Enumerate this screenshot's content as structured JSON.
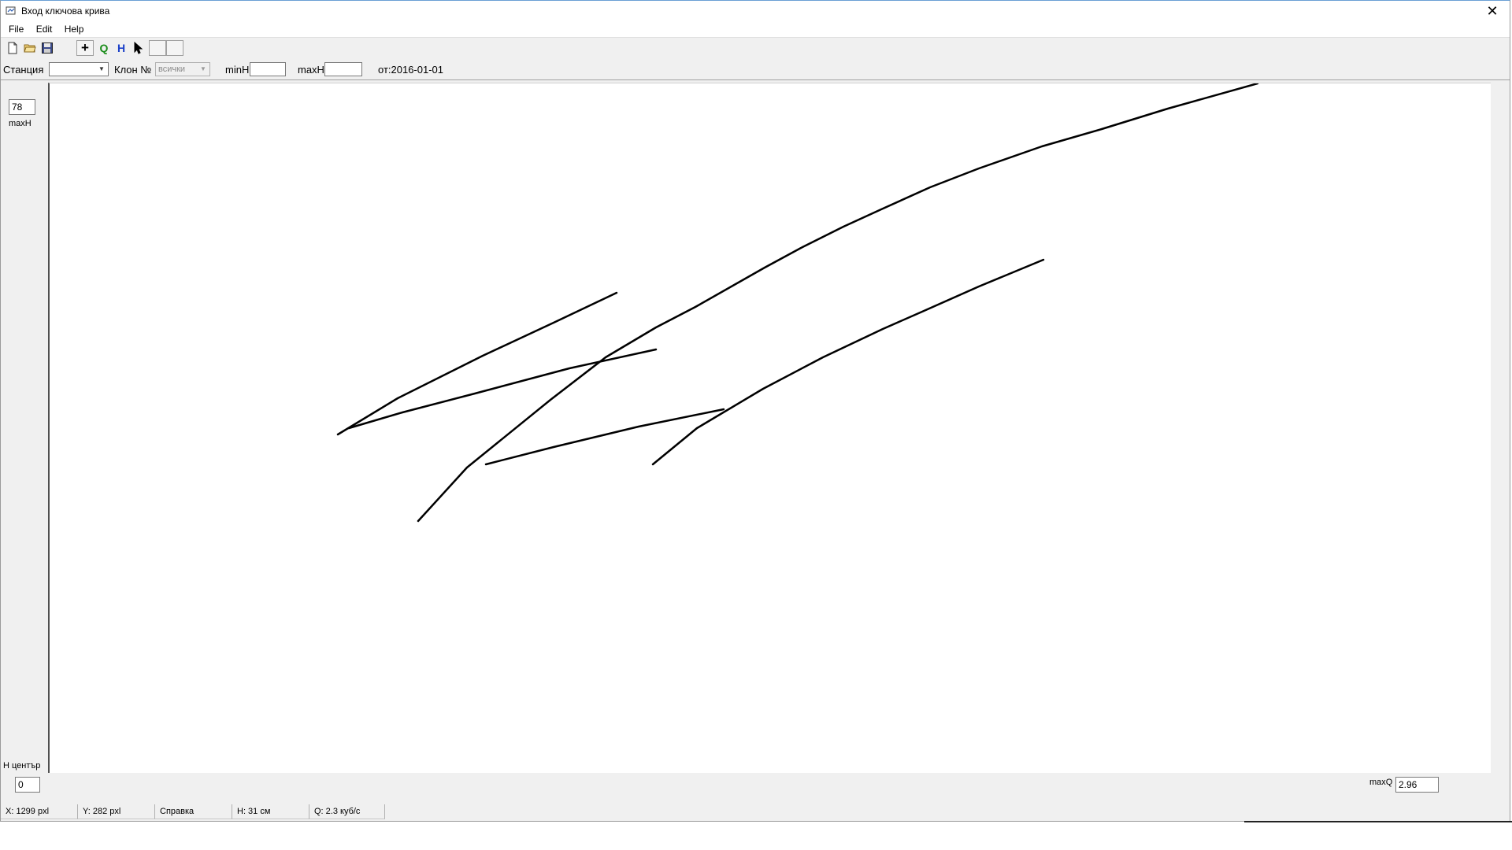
{
  "window": {
    "title": "Вход ключова крива",
    "close_glyph": "✕",
    "title_icon": "app-icon"
  },
  "menu": {
    "items": [
      "File",
      "Edit",
      "Help"
    ]
  },
  "toolbar": {
    "buttons": [
      {
        "name": "new-file-icon"
      },
      {
        "name": "open-folder-icon"
      },
      {
        "name": "save-icon"
      },
      {
        "name": "add-point-button",
        "label": "+",
        "color": "#000000"
      },
      {
        "name": "q-mode-button",
        "label": "Q",
        "color": "#1a8c1a"
      },
      {
        "name": "h-mode-button",
        "label": "H",
        "color": "#1a3fc8"
      },
      {
        "name": "pointer-icon"
      }
    ]
  },
  "filters": {
    "station_label": "Станция",
    "station_value": "",
    "branch_label": "Клон №",
    "branch_value": "всички",
    "minH_label": "minH",
    "minH_value": "",
    "maxH_label": "maxH",
    "maxH_value": "",
    "from_label": "от:2016-01-01"
  },
  "left_panel": {
    "maxH_value": "78",
    "maxH_label": "maxH",
    "h_center_label": "Н център",
    "h_center_value": "0"
  },
  "bottom": {
    "maxQ_label": "maxQ",
    "maxQ_value": "2.96"
  },
  "status": {
    "x": "X: 1299 pxl",
    "y": "Y: 282 pxl",
    "help": "Справка",
    "h": "H:  31 см",
    "q": "Q:  2.3 куб/с"
  },
  "curves_color": "#000000"
}
